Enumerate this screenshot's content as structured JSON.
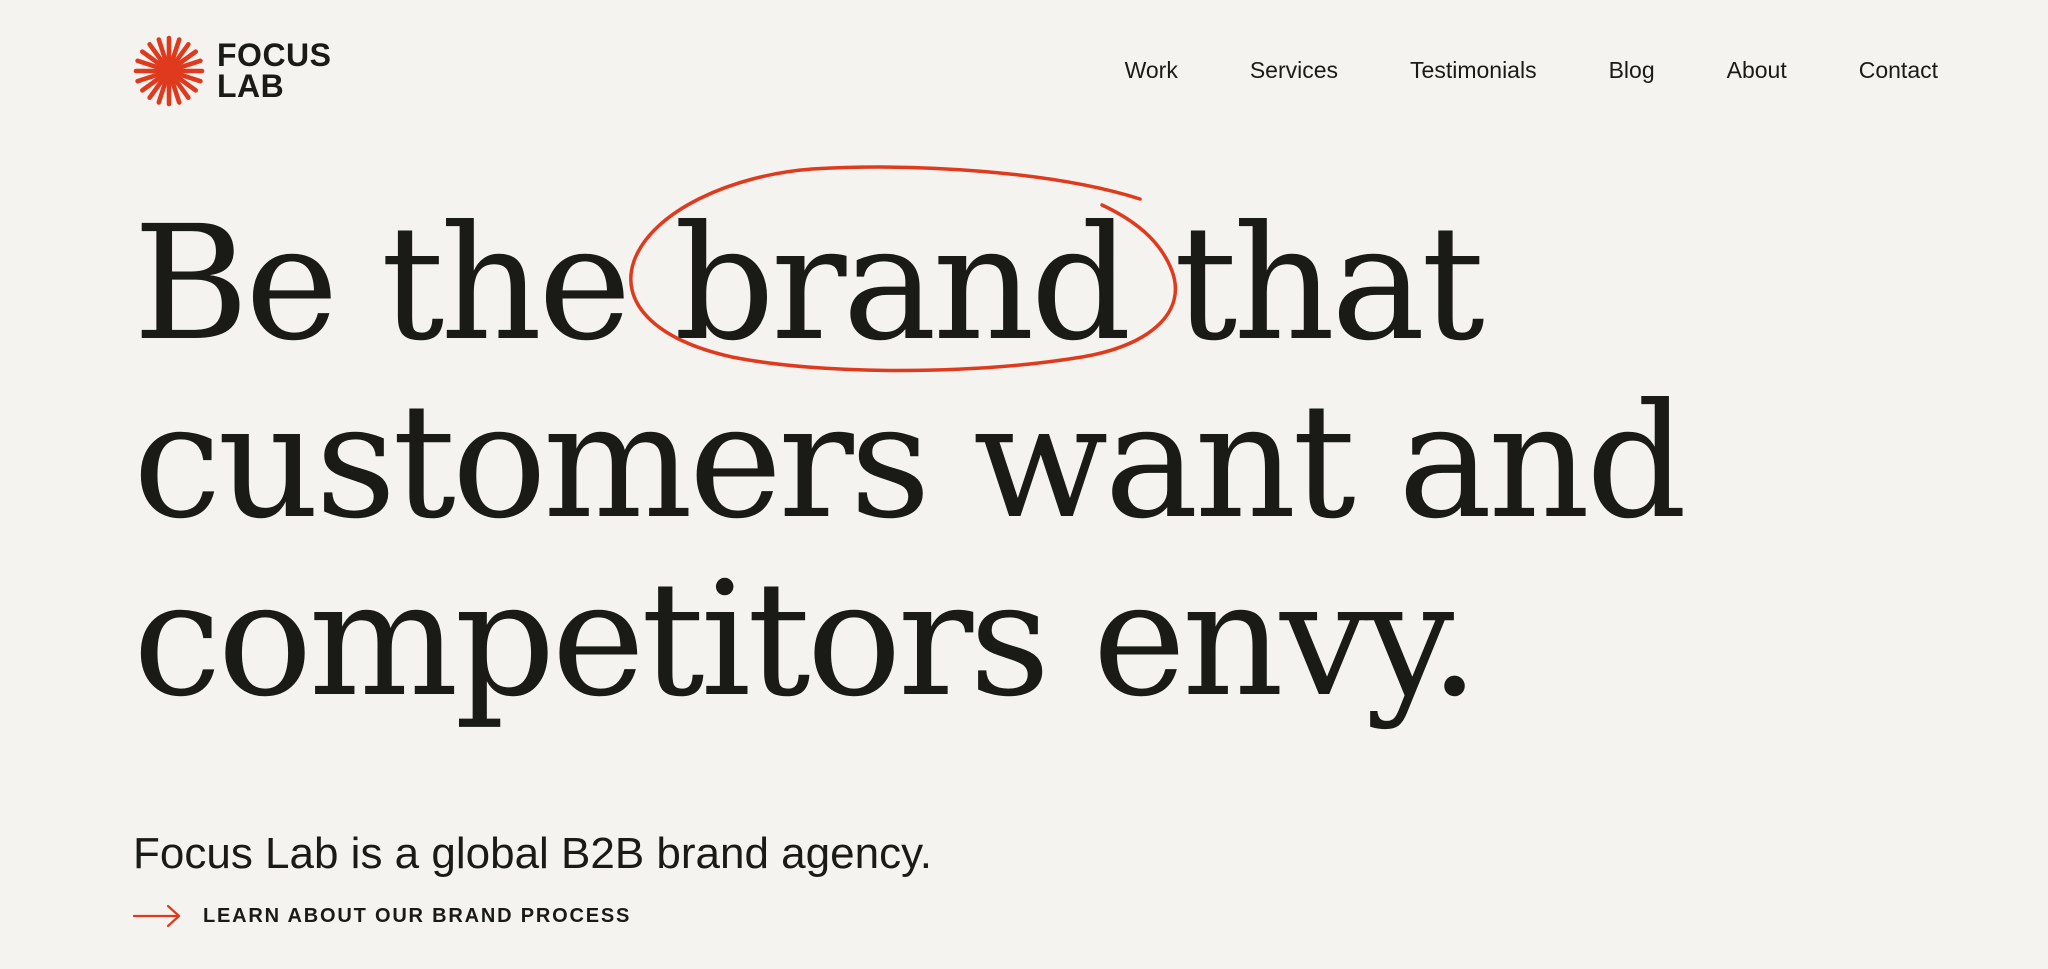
{
  "brand": {
    "name_line1": "FOCUS",
    "name_line2": "LAB",
    "accent_color": "#e03a1e",
    "logo_icon": "starburst-icon"
  },
  "nav": {
    "items": [
      {
        "label": "Work"
      },
      {
        "label": "Services"
      },
      {
        "label": "Testimonials"
      },
      {
        "label": "Blog"
      },
      {
        "label": "About"
      },
      {
        "label": "Contact"
      }
    ]
  },
  "hero": {
    "headline": {
      "line1_before": "Be the ",
      "line1_circled": "brand",
      "line1_after": " that",
      "line2": "customers want and",
      "line3": "competitors envy."
    },
    "subheading": "Focus Lab is a global B2B brand agency.",
    "cta": {
      "label": "LEARN ABOUT OUR BRAND PROCESS",
      "icon": "arrow-right-icon"
    }
  }
}
